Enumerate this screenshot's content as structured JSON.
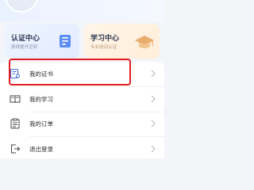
{
  "cards": {
    "cert": {
      "title": "认证中心",
      "subtitle": "获得提升空间",
      "icon": "document-icon"
    },
    "learn": {
      "title": "学习中心",
      "subtitle": "专业培训认证",
      "icon": "graduation-cap-icon"
    }
  },
  "menu": {
    "items": [
      {
        "label": "我的证书",
        "icon": "certificate-icon",
        "highlighted": true
      },
      {
        "label": "我的学习",
        "icon": "book-icon"
      },
      {
        "label": "我的订单",
        "icon": "clipboard-icon"
      },
      {
        "label": "退出登录",
        "icon": "logout-icon"
      }
    ]
  },
  "colors": {
    "highlight": "#e31b23",
    "cert_accent": "#5b8df5",
    "learn_accent": "#e3a765",
    "icon_stroke": "#555555",
    "chevron": "#b3b3b3"
  }
}
